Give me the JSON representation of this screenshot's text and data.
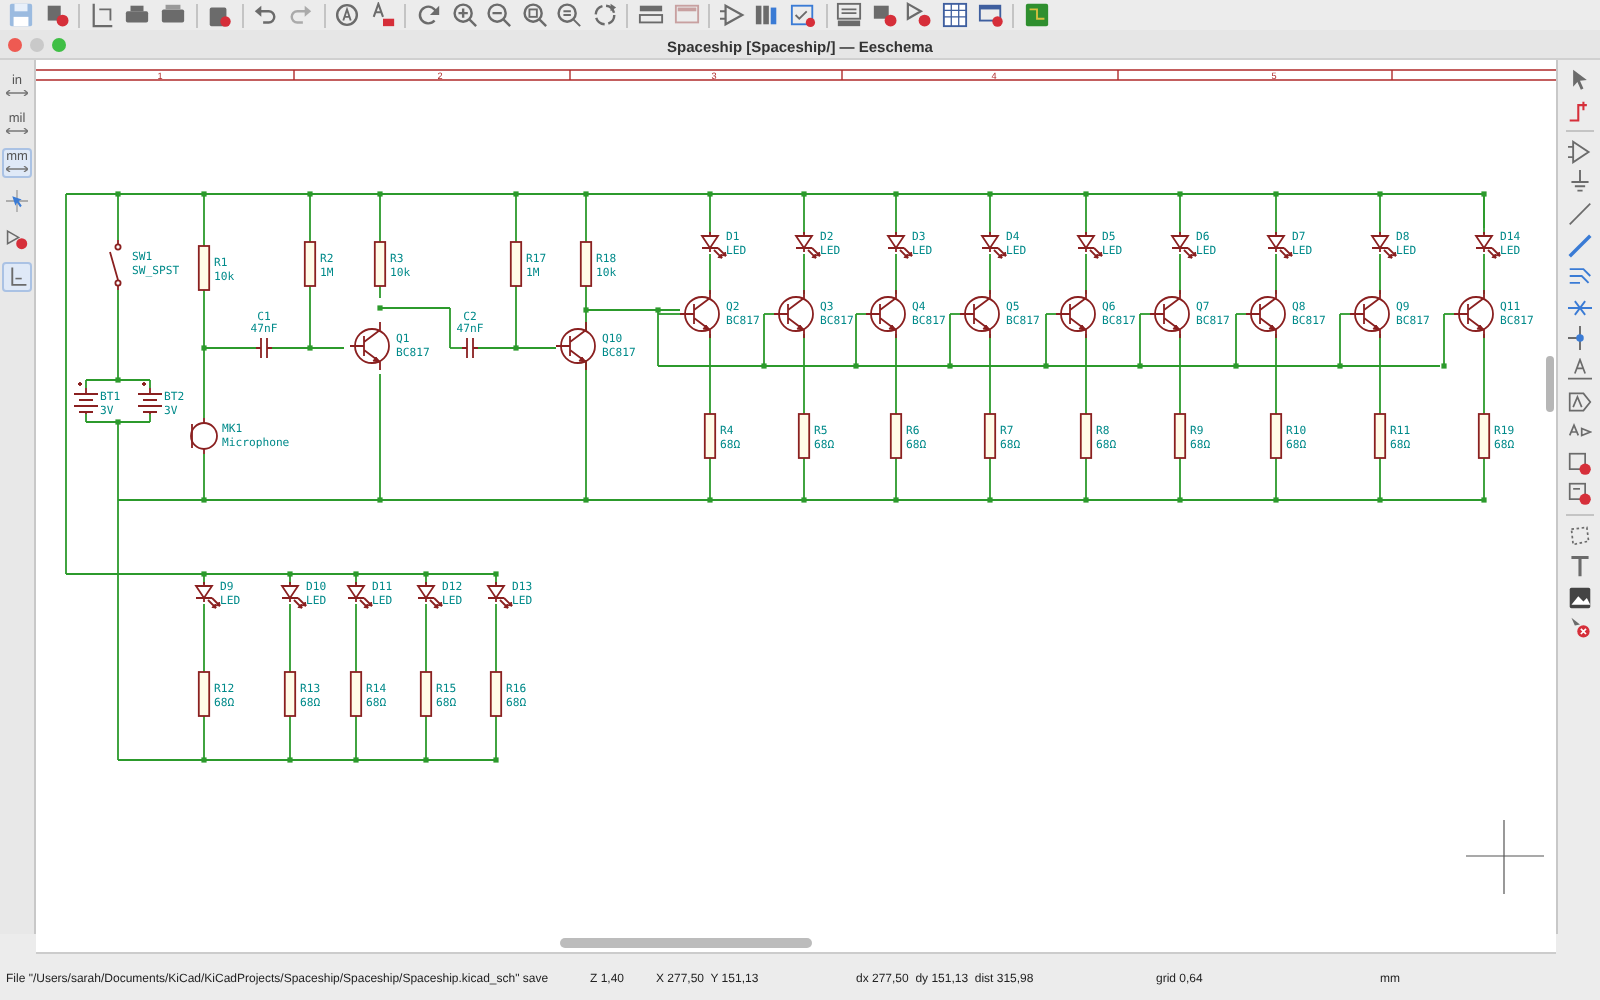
{
  "window": {
    "title": "Spaceship [Spaceship/] — Eeschema"
  },
  "units": [
    {
      "label": "in",
      "selected": false
    },
    {
      "label": "mil",
      "selected": false
    },
    {
      "label": "mm",
      "selected": true
    }
  ],
  "left_tools": [
    {
      "selected": false
    },
    {
      "selected": false
    },
    {
      "selected": true
    }
  ],
  "frame": {
    "column_numbers": [
      "1",
      "2",
      "3",
      "4",
      "5"
    ]
  },
  "input_stage": {
    "switch": {
      "ref": "SW1",
      "value": "SW_SPST"
    },
    "batteries": [
      {
        "ref": "BT1",
        "value": "3V"
      },
      {
        "ref": "BT2",
        "value": "3V"
      }
    ],
    "microphone": {
      "ref": "MK1",
      "value": "Microphone"
    },
    "resistors": [
      {
        "ref": "R1",
        "value": "10k"
      },
      {
        "ref": "R2",
        "value": "1M"
      },
      {
        "ref": "R3",
        "value": "10k"
      },
      {
        "ref": "R17",
        "value": "1M"
      },
      {
        "ref": "R18",
        "value": "10k"
      }
    ],
    "capacitors": [
      {
        "ref": "C1",
        "value": "47nF"
      },
      {
        "ref": "C2",
        "value": "47nF"
      }
    ],
    "transistors": [
      {
        "ref": "Q1",
        "value": "BC817"
      },
      {
        "ref": "Q10",
        "value": "BC817"
      }
    ]
  },
  "led_columns": [
    {
      "led": {
        "ref": "D1",
        "value": "LED"
      },
      "transistor": {
        "ref": "Q2",
        "value": "BC817"
      },
      "resistor": {
        "ref": "R4",
        "value": "68Ω"
      }
    },
    {
      "led": {
        "ref": "D2",
        "value": "LED"
      },
      "transistor": {
        "ref": "Q3",
        "value": "BC817"
      },
      "resistor": {
        "ref": "R5",
        "value": "68Ω"
      }
    },
    {
      "led": {
        "ref": "D3",
        "value": "LED"
      },
      "transistor": {
        "ref": "Q4",
        "value": "BC817"
      },
      "resistor": {
        "ref": "R6",
        "value": "68Ω"
      }
    },
    {
      "led": {
        "ref": "D4",
        "value": "LED"
      },
      "transistor": {
        "ref": "Q5",
        "value": "BC817"
      },
      "resistor": {
        "ref": "R7",
        "value": "68Ω"
      }
    },
    {
      "led": {
        "ref": "D5",
        "value": "LED"
      },
      "transistor": {
        "ref": "Q6",
        "value": "BC817"
      },
      "resistor": {
        "ref": "R8",
        "value": "68Ω"
      }
    },
    {
      "led": {
        "ref": "D6",
        "value": "LED"
      },
      "transistor": {
        "ref": "Q7",
        "value": "BC817"
      },
      "resistor": {
        "ref": "R9",
        "value": "68Ω"
      }
    },
    {
      "led": {
        "ref": "D7",
        "value": "LED"
      },
      "transistor": {
        "ref": "Q8",
        "value": "BC817"
      },
      "resistor": {
        "ref": "R10",
        "value": "68Ω"
      }
    },
    {
      "led": {
        "ref": "D8",
        "value": "LED"
      },
      "transistor": {
        "ref": "Q9",
        "value": "BC817"
      },
      "resistor": {
        "ref": "R11",
        "value": "68Ω"
      }
    },
    {
      "led": {
        "ref": "D14",
        "value": "LED"
      },
      "transistor": {
        "ref": "Q11",
        "value": "BC817"
      },
      "resistor": {
        "ref": "R19",
        "value": "68Ω"
      }
    }
  ],
  "lower_led_columns": [
    {
      "led": {
        "ref": "D9",
        "value": "LED"
      },
      "resistor": {
        "ref": "R12",
        "value": "68Ω"
      }
    },
    {
      "led": {
        "ref": "D10",
        "value": "LED"
      },
      "resistor": {
        "ref": "R13",
        "value": "68Ω"
      }
    },
    {
      "led": {
        "ref": "D11",
        "value": "LED"
      },
      "resistor": {
        "ref": "R14",
        "value": "68Ω"
      }
    },
    {
      "led": {
        "ref": "D12",
        "value": "LED"
      },
      "resistor": {
        "ref": "R15",
        "value": "68Ω"
      }
    },
    {
      "led": {
        "ref": "D13",
        "value": "LED"
      },
      "resistor": {
        "ref": "R16",
        "value": "68Ω"
      }
    }
  ],
  "status_bar": {
    "file": "File \"/Users/sarah/Documents/KiCad/KiCadProjects/Spaceship/Spaceship/Spaceship.kicad_sch\" save",
    "zoom": "Z 1,40",
    "cursor": "X 277,50  Y 151,13",
    "delta": "dx 277,50  dy 151,13  dist 315,98",
    "grid": "grid 0,64",
    "units": "mm"
  }
}
